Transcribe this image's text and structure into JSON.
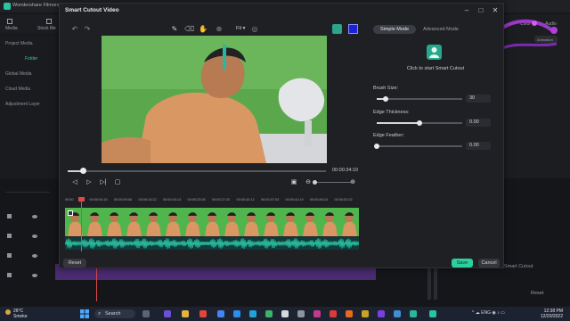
{
  "background_app": {
    "title": "Wondershare Filmora",
    "tabs": [
      "Media",
      "Stock Me"
    ],
    "sidebar": [
      "Project Media",
      "Folder",
      "Global Media",
      "Cloud Media",
      "Adjustment Layer"
    ],
    "right_tabs": [
      "Color",
      "Audio"
    ],
    "right_button": "Animation",
    "smart_cutout_label": "Smart Cutout",
    "reset_label": "Reset"
  },
  "dialog": {
    "title": "Smart Cutout Video",
    "toolbar": {
      "fit_label": "Fit",
      "brush_color": "#1a23d8",
      "icons": [
        "undo-icon",
        "redo-icon",
        "brush-icon",
        "eraser-icon",
        "hand-icon",
        "zoom-icon",
        "person-icon",
        "color-swatch"
      ]
    },
    "playback": {
      "timecode": "00:00:34:10",
      "progress_fraction": 0.06
    },
    "timeline": {
      "ticks": [
        "00:00",
        "00:00:04:15",
        "00:00:09:06",
        "00:00:13:22",
        "00:00:18:13",
        "00:00:23:05",
        "00:00:27:20",
        "00:00:32:12",
        "00:00:37:03",
        "00:00:41:19",
        "00:00:46:10",
        "00:00:51:02"
      ]
    },
    "modes": {
      "simple": "Simple Mode",
      "advanced": "Advanced Mode"
    },
    "cutout_hint": "Click to start Smart Cutout",
    "params": [
      {
        "label": "Brush Size:",
        "value": "30",
        "fraction": 0.1
      },
      {
        "label": "Edge Thickness:",
        "value": "0.00",
        "fraction": 0.5
      },
      {
        "label": "Edge Feather:",
        "value": "0.00",
        "fraction": 0.0
      }
    ],
    "buttons": {
      "reset": "Reset",
      "save": "Save",
      "cancel": "Cancel"
    }
  },
  "taskbar": {
    "temperature": "26°C",
    "weather": "Smoke",
    "search": "Search",
    "language": "ENG",
    "time": "12:38 PM",
    "date": "12/20/2022"
  }
}
